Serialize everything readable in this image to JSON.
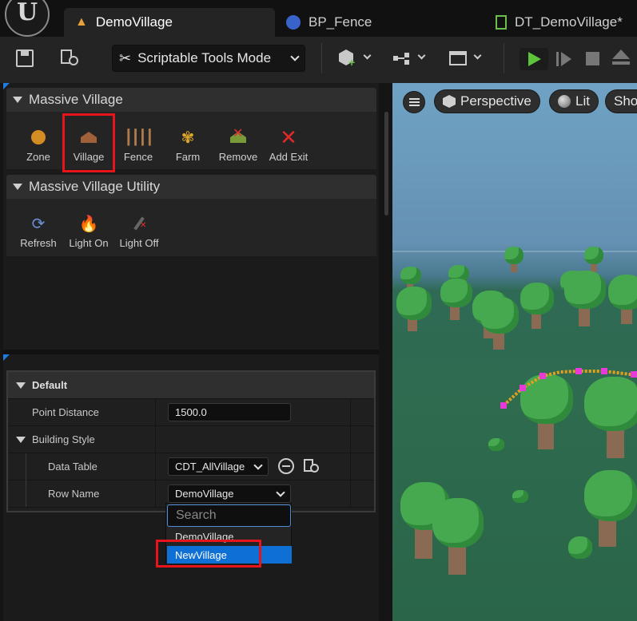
{
  "tabs": [
    {
      "label": "DemoVillage"
    },
    {
      "label": "BP_Fence"
    },
    {
      "label": "DT_DemoVillage*"
    }
  ],
  "toolbar": {
    "mode_label": "Scriptable Tools Mode"
  },
  "panels": [
    {
      "title": "Massive Village",
      "tools": [
        "Zone",
        "Village",
        "Fence",
        "Farm",
        "Remove",
        "Add Exit"
      ]
    },
    {
      "title": "Massive Village Utility",
      "tools": [
        "Refresh",
        "Light On",
        "Light Off"
      ]
    }
  ],
  "details": {
    "category": "Default",
    "point_distance_label": "Point Distance",
    "point_distance_value": "1500.0",
    "building_style_label": "Building Style",
    "data_table_label": "Data Table",
    "data_table_value": "CDT_AllVillage",
    "row_name_label": "Row Name",
    "row_name_value": "DemoVillage"
  },
  "dropdown": {
    "search_placeholder": "Search",
    "options": [
      "DemoVillage",
      "NewVillage"
    ],
    "highlighted": "NewVillage"
  },
  "viewport": {
    "perspective_label": "Perspective",
    "lit_label": "Lit",
    "show_label": "Sho"
  },
  "colors": {
    "accent": "#1e7be0",
    "highlight_box": "#e8141b",
    "selected_option": "#0e70d4"
  }
}
